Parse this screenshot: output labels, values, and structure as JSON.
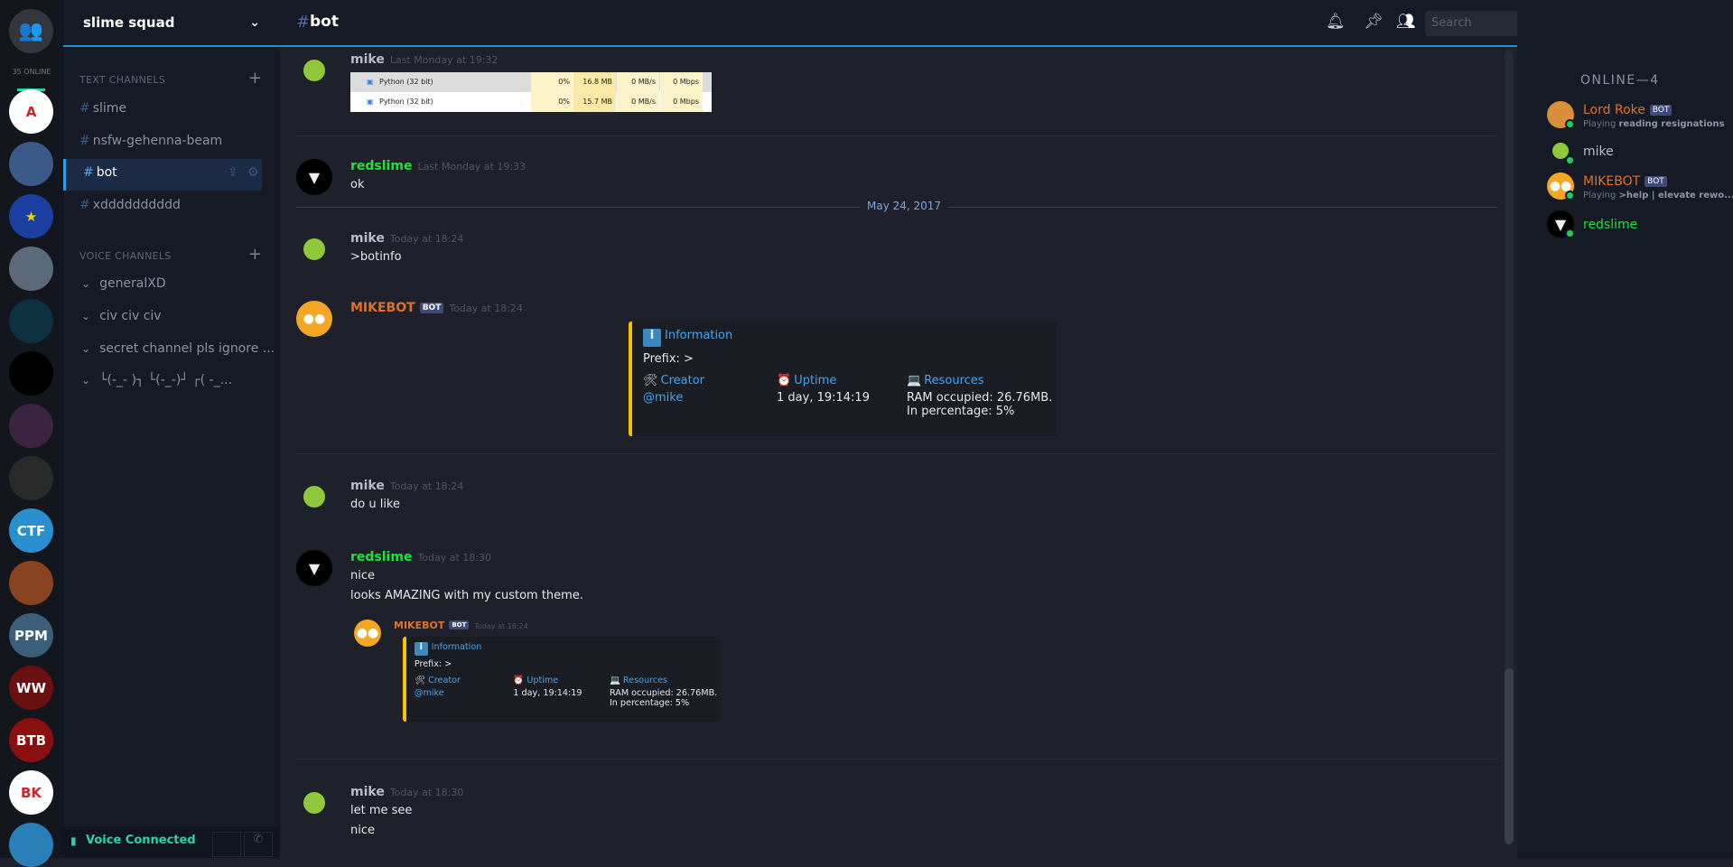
{
  "colors": {
    "accent": "#2b8ec4",
    "online": "#17d35a",
    "bot_orange": "#e0702a",
    "redslime_green": "#1fe23a",
    "embed_bar": "#f5c400",
    "link": "#44a4f0"
  },
  "rail": {
    "online_count": "35 ONLINE",
    "servers": [
      {
        "label": "A",
        "color": "#ffffff",
        "fg": "#c22"
      },
      {
        "label": "",
        "color": "#3c5a88"
      },
      {
        "label": "★",
        "color": "#1b3fa0",
        "fg": "#f5d000"
      },
      {
        "label": "",
        "color": "#5b6a7a"
      },
      {
        "label": "",
        "color": "#0d3140",
        "fg": "#4bc9d9"
      },
      {
        "label": "",
        "color": "#000000"
      },
      {
        "label": "",
        "color": "#3a2440"
      },
      {
        "label": "",
        "color": "#2a2a2a"
      },
      {
        "label": "CTF",
        "color": "#2a8fcf"
      },
      {
        "label": "",
        "color": "#8a4320"
      },
      {
        "label": "PPM",
        "color": "#3b5e7a"
      },
      {
        "label": "WW",
        "color": "#6a1010"
      },
      {
        "label": "BTB",
        "color": "#8a0f0f"
      },
      {
        "label": "BK",
        "color": "#ffffff",
        "fg": "#d2232a"
      },
      {
        "label": "",
        "color": "#2a7fb8"
      }
    ]
  },
  "sidebar": {
    "server_name": "slime squad",
    "text_header": "TEXT CHANNELS",
    "voice_header": "VOICE CHANNELS",
    "text_channels": [
      "slime",
      "nsfw-gehenna-beam",
      "bot",
      "xdddddddddd"
    ],
    "voice_channels": [
      "generalXD",
      "civ civ civ",
      "secret channel pls ignore ...",
      "└(-_- )┐ └(-_-)┘ ┌( -_..."
    ],
    "voice_status": "Voice Connected"
  },
  "header": {
    "channel": "bot",
    "search_placeholder": "Search"
  },
  "messages": [
    {
      "author": "mike",
      "time": "Last Monday at 19:32",
      "color": "#b9bec6",
      "lines": [],
      "table": [
        [
          "Python (32 bit)",
          "0%",
          "16.8 MB",
          "0 MB/s",
          "0 Mbps"
        ],
        [
          "Python (32 bit)",
          "0%",
          "15.7 MB",
          "0 MB/s",
          "0 Mbps"
        ]
      ]
    },
    {
      "author": "redslime",
      "time": "Last Monday at 19:33",
      "color": "#1fe23a",
      "lines": [
        "ok"
      ]
    },
    {
      "author": "mike",
      "time": "Today at 18:24",
      "color": "#b9bec6",
      "lines": [
        ">botinfo"
      ]
    },
    {
      "author": "MIKEBOT",
      "time": "Today at 18:24",
      "color": "#e0702a",
      "bot": "BOT",
      "lines": []
    },
    {
      "author": "mike",
      "time": "Today at 18:24",
      "color": "#b9bec6",
      "lines": [
        "do u like"
      ]
    },
    {
      "author": "redslime",
      "time": "Today at 18:30",
      "color": "#1fe23a",
      "lines": [
        "nice",
        "looks AMAZING with my custom theme."
      ]
    },
    {
      "author": "mike",
      "time": "Today at 18:30",
      "color": "#b9bec6",
      "lines": [
        "let me see",
        "nice"
      ]
    }
  ],
  "date_divider": "May 24, 2017",
  "embed": {
    "title": "Information",
    "prefix": "Prefix: >",
    "fields": [
      {
        "name": "Creator",
        "value": "@mike",
        "icon": "🛠"
      },
      {
        "name": "Uptime",
        "value": "1 day, 19:14:19",
        "icon": "⏰"
      },
      {
        "name": "Resources",
        "value": "RAM occupied: 26.76MB.",
        "value2": "In percentage: 5%",
        "icon": "💻"
      }
    ]
  },
  "quoted": {
    "author": "MIKEBOT",
    "bot": "BOT",
    "time": "Today at 18:24"
  },
  "members": {
    "header": "ONLINE—4",
    "list": [
      {
        "name": "Lord Roke",
        "bot": "BOT",
        "color": "#e0702a",
        "status_prefix": "Playing ",
        "status": "reading resignations"
      },
      {
        "name": "mike",
        "color": "#b9bec6"
      },
      {
        "name": "MIKEBOT",
        "bot": "BOT",
        "color": "#e0702a",
        "status_prefix": "Playing ",
        "status": ">help | elevate rewo..."
      },
      {
        "name": "redslime",
        "color": "#1fe23a"
      }
    ]
  }
}
